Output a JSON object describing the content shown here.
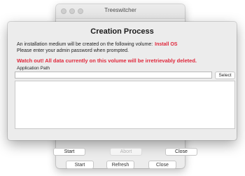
{
  "background_window": {
    "title": "Treeswitcher",
    "buttons": [
      "Start",
      "Refresh",
      "Close"
    ]
  },
  "sheet": {
    "title": "Creation Process",
    "info_line": "An installation medium will be created on the following volume:",
    "volume_name": "Install OS",
    "password_line": "Please enter your admin password when prompted.",
    "warning": "Watch out! All data currently on this volume will be irretrievably deleted.",
    "path_label": "Application Path",
    "path_value": "",
    "select_label": "Select",
    "buttons": {
      "start": "Start",
      "abort": "Abort",
      "close": "Close"
    }
  },
  "colors": {
    "warning": "#e0263a",
    "disabled_text": "#b4b4b4"
  }
}
